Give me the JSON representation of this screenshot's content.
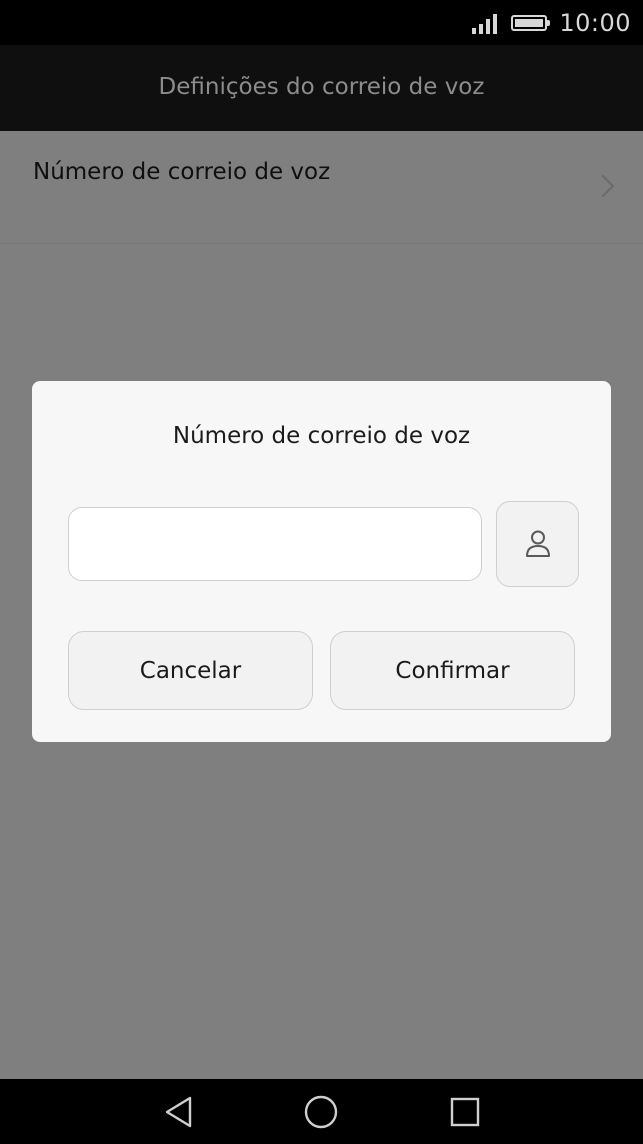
{
  "status_bar": {
    "time": "10:00",
    "icons": [
      "signal-icon",
      "battery-icon"
    ]
  },
  "header": {
    "title": "Definições do correio de voz"
  },
  "settings_list": {
    "items": [
      {
        "label": "Número de correio de voz",
        "icon": "chevron-right-icon"
      }
    ]
  },
  "dialog": {
    "title": "Número de correio de voz",
    "input": {
      "value": "",
      "placeholder": ""
    },
    "contact_icon": "person-icon",
    "cancel_label": "Cancelar",
    "confirm_label": "Confirmar"
  },
  "nav_bar": {
    "icons": [
      "back-icon",
      "home-icon",
      "recents-icon"
    ]
  },
  "colors": {
    "overlay": "#7f7f7f",
    "status_bar": "#000000",
    "title_bar": "#0f0f0f",
    "dialog_bg": "#f7f7f7",
    "button_bg": "#f2f2f2",
    "text": "#1b1b1b"
  }
}
